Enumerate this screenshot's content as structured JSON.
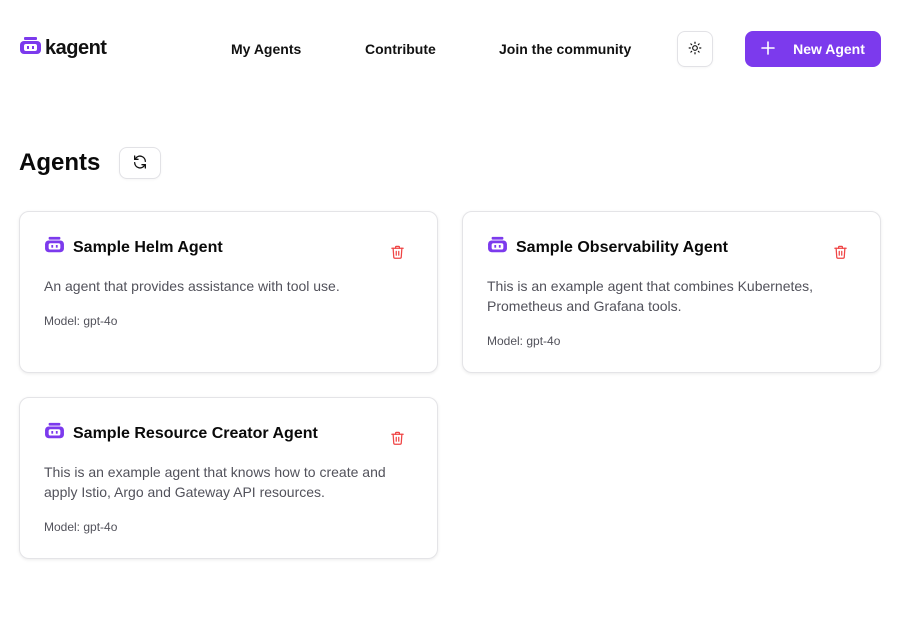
{
  "header": {
    "logo_text": "kagent",
    "nav": [
      {
        "label": "My Agents"
      },
      {
        "label": "Contribute"
      },
      {
        "label": "Join the community"
      }
    ],
    "theme_icon": "sun-icon",
    "new_agent_label": "New Agent",
    "new_agent_icon": "plus-icon"
  },
  "main": {
    "title": "Agents",
    "refresh_icon": "refresh-icon"
  },
  "agents": [
    {
      "name": "Sample Helm Agent",
      "description": "An agent that provides assistance with tool use.",
      "model": "Model: gpt-4o"
    },
    {
      "name": "Sample Observability Agent",
      "description": "This is an example agent that combines Kubernetes, Prometheus and Grafana tools.",
      "model": "Model: gpt-4o"
    },
    {
      "name": "Sample Resource Creator Agent",
      "description": "This is an example agent that knows how to create and apply Istio, Argo and Gateway API resources.",
      "model": "Model: gpt-4o"
    }
  ],
  "colors": {
    "accent": "#7c3aed",
    "delete": "#ef4444",
    "text_muted": "#52525b"
  }
}
